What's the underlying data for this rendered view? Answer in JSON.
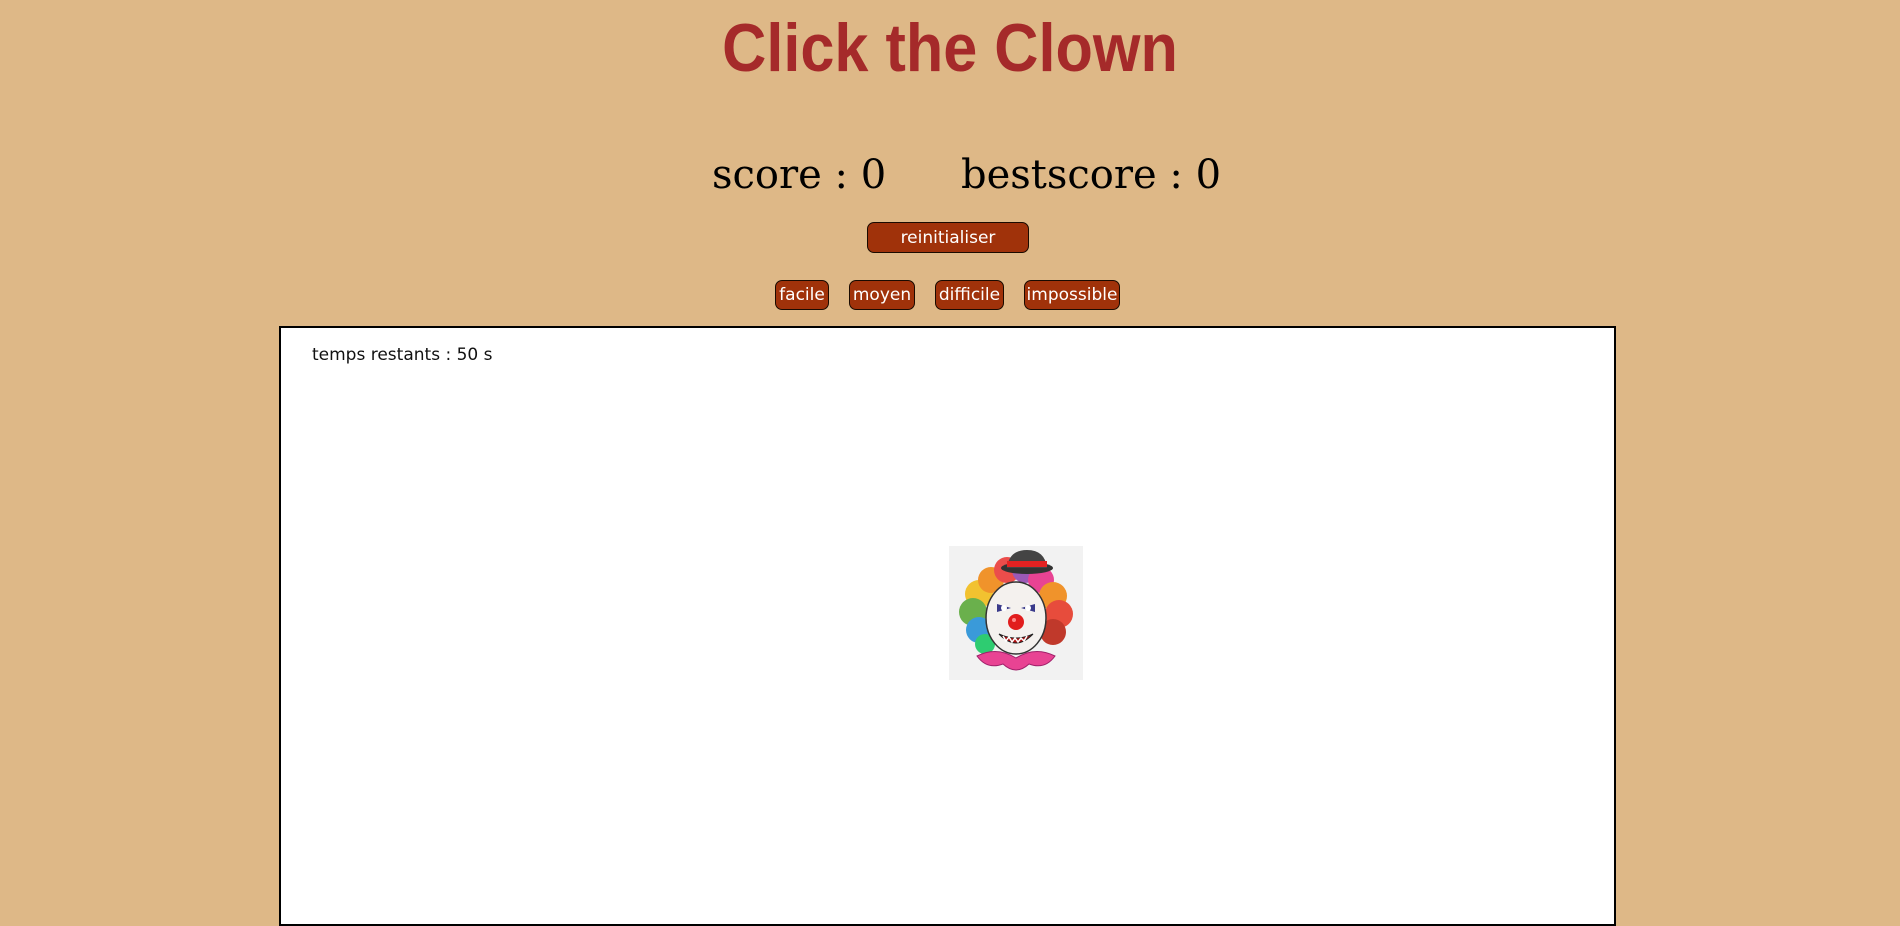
{
  "title": "Click the Clown",
  "scoreboard": {
    "score_text": "score : 0",
    "bestscore_text": "bestscore : 0"
  },
  "buttons": {
    "reset": "reinitialiser",
    "levels": [
      "facile",
      "moyen",
      "difficile",
      "impossible"
    ]
  },
  "board": {
    "timer_text": "temps restants : 50 s"
  },
  "colors": {
    "background": "#deb887",
    "title": "#a52a2a",
    "button": "#a0320a",
    "board": "#ffffff"
  },
  "icons": {
    "target": "clown-icon"
  }
}
